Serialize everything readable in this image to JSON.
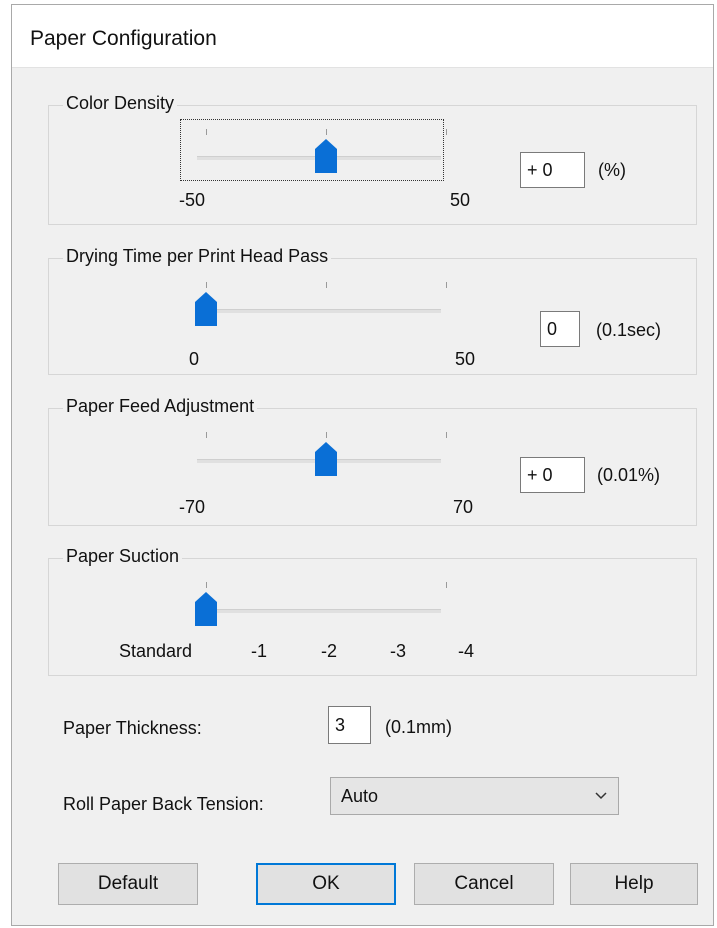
{
  "dialog": {
    "title": "Paper Configuration"
  },
  "color_density": {
    "label": "Color Density",
    "min_label": "-50",
    "max_label": "50",
    "value": "+ 0",
    "unit": "(%)",
    "position": 0.5
  },
  "drying_time": {
    "label": "Drying Time per Print Head Pass",
    "min_label": "0",
    "max_label": "50",
    "value": "0",
    "unit": "(0.1sec)",
    "position": 0
  },
  "paper_feed": {
    "label": "Paper Feed Adjustment",
    "min_label": "-70",
    "max_label": "70",
    "value": "+ 0",
    "unit": "(0.01%)",
    "position": 0.5
  },
  "paper_suction": {
    "label": "Paper Suction",
    "scale": [
      "Standard",
      "-1",
      "-2",
      "-3",
      "-4"
    ],
    "position": 0
  },
  "paper_thickness": {
    "label": "Paper Thickness:",
    "value": "3",
    "unit": "(0.1mm)"
  },
  "roll_tension": {
    "label": "Roll Paper Back Tension:",
    "value": "Auto"
  },
  "buttons": {
    "default": "Default",
    "ok": "OK",
    "cancel": "Cancel",
    "help": "Help"
  },
  "colors": {
    "accent": "#0078d7",
    "thumb": "#0a6fd6",
    "dialog_bg": "#f0f0f0"
  }
}
